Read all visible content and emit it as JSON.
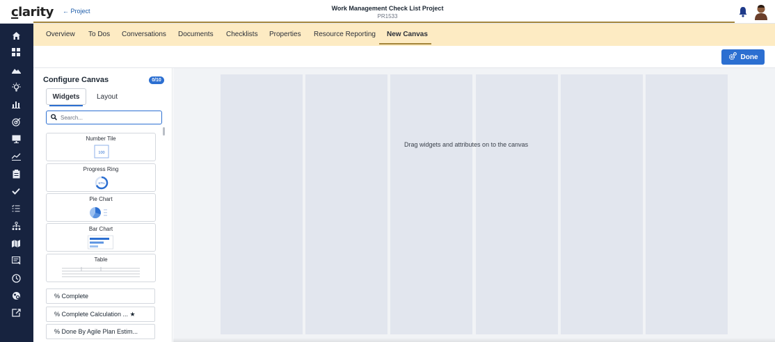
{
  "header": {
    "logo": "clarity",
    "back_link": "← Project",
    "project_title": "Work Management Check List Project",
    "project_id": "PR1533"
  },
  "sidebar": {
    "icons": [
      "home-icon",
      "grid-icon",
      "landscape-icon",
      "idea-icon",
      "bar-chart-icon",
      "target-icon",
      "monitor-icon",
      "trend-icon",
      "clipboard-icon",
      "check-icon",
      "checklist-icon",
      "org-chart-icon",
      "map-icon",
      "report-icon",
      "clock-icon",
      "settings-group-icon",
      "export-icon"
    ]
  },
  "tabs": [
    "Overview",
    "To Dos",
    "Conversations",
    "Documents",
    "Checklists",
    "Properties",
    "Resource Reporting",
    "New Canvas"
  ],
  "active_tab": "New Canvas",
  "toolbar": {
    "done_label": "Done"
  },
  "panel": {
    "title": "Configure Canvas",
    "badge": "0/10",
    "tab_widgets": "Widgets",
    "tab_layout": "Layout",
    "search_placeholder": "Search...",
    "widgets": [
      {
        "label": "Number Tile",
        "thumb_text": "100"
      },
      {
        "label": "Progress Ring",
        "thumb_text": "67%"
      },
      {
        "label": "Pie Chart"
      },
      {
        "label": "Bar Chart"
      },
      {
        "label": "Table"
      }
    ],
    "attributes": [
      "% Complete",
      "% Complete Calculation ...  ★",
      "% Done By Agile Plan Estim..."
    ]
  },
  "canvas": {
    "empty_message": "Drag widgets and attributes on to the canvas"
  },
  "colors": {
    "sidebar_bg": "#17233f",
    "tabbar_bg": "#fdebc3",
    "accent_blue": "#2c6fd1",
    "gold_accent": "#a4853a"
  }
}
